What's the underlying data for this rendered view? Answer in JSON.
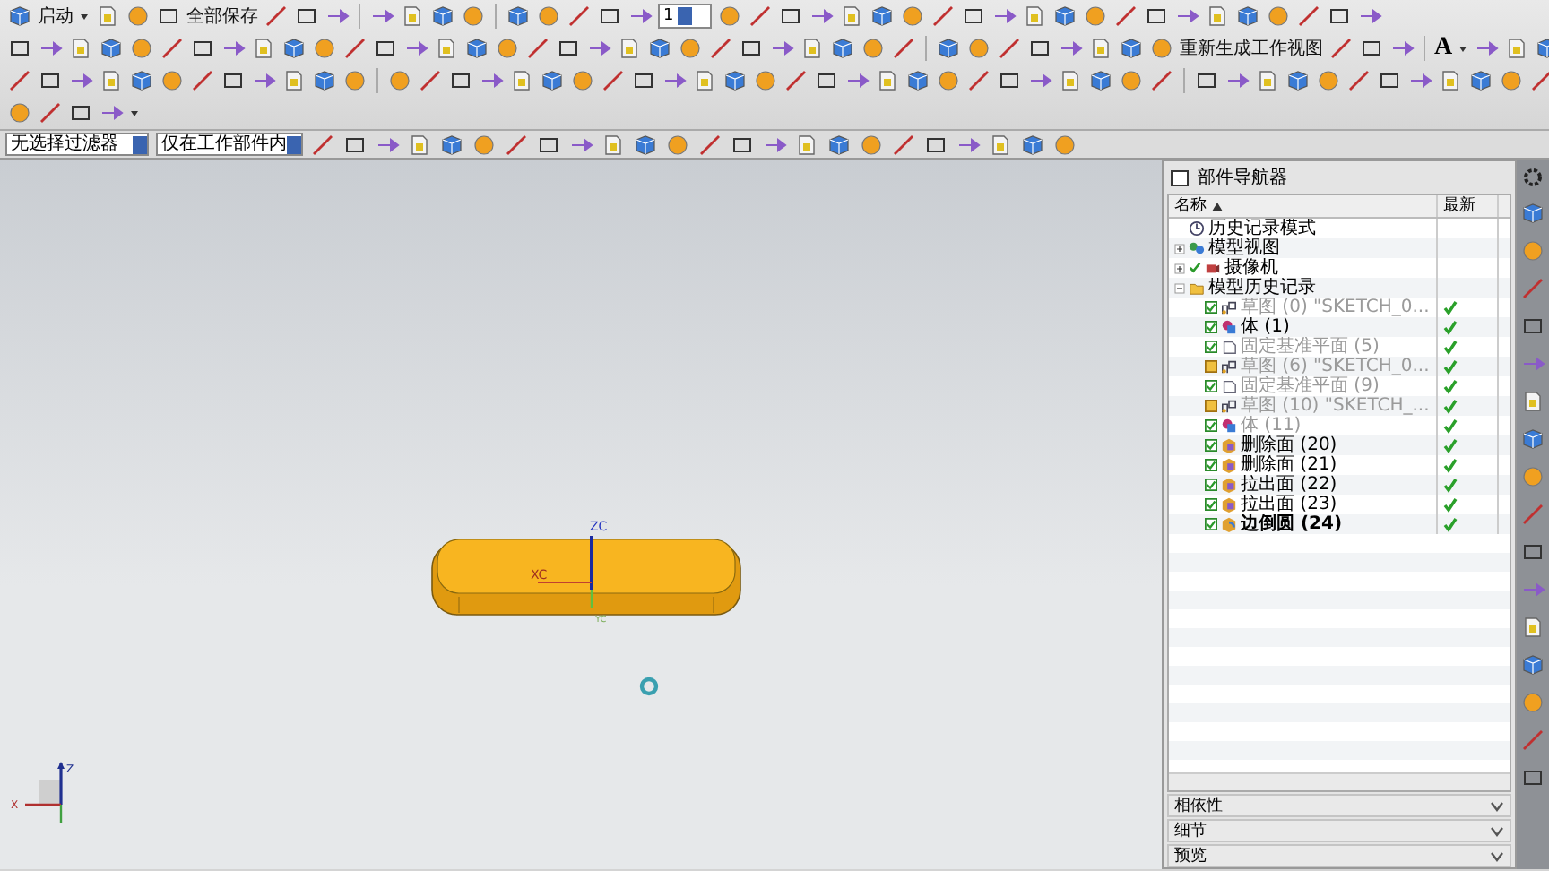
{
  "toolbar": {
    "start_label": "启动",
    "save_all_label": "全部保存",
    "layer_value": "1",
    "regenerate_label": "重新生成工作视图",
    "text_tool": "A"
  },
  "filter_bar": {
    "type_filter": "无选择过滤器",
    "scope_filter": "仅在工作部件内"
  },
  "viewport": {
    "axis_labels": [
      "ZC",
      "XC",
      "YC"
    ],
    "triad_labels": [
      "Z",
      "X"
    ]
  },
  "part_navigator": {
    "title": "部件导航器",
    "columns": [
      {
        "label": "名称",
        "sorted": true
      },
      {
        "label": "最新"
      }
    ],
    "tree": [
      {
        "label": "历史记录模式",
        "kind": "mode"
      },
      {
        "label": "模型视图",
        "kind": "views",
        "expanded": false
      },
      {
        "label": "摄像机",
        "kind": "camera",
        "expanded": false,
        "checked": true
      },
      {
        "label": "模型历史记录",
        "kind": "folder",
        "expanded": true,
        "children": [
          {
            "label": "草图 (0) \"SKETCH_0...",
            "kind": "sketch",
            "checked": true,
            "dimmed": true,
            "current": false,
            "up_to_date": true
          },
          {
            "label": "体 (1)",
            "kind": "body",
            "checked": true,
            "dimmed": false,
            "current": false,
            "up_to_date": true
          },
          {
            "label": "固定基准平面 (5)",
            "kind": "plane",
            "checked": true,
            "dimmed": true,
            "current": false,
            "up_to_date": true
          },
          {
            "label": "草图 (6) \"SKETCH_0...",
            "kind": "sketch",
            "checked": false,
            "dimmed": true,
            "current": false,
            "up_to_date": true
          },
          {
            "label": "固定基准平面 (9)",
            "kind": "plane",
            "checked": true,
            "dimmed": true,
            "current": false,
            "up_to_date": true
          },
          {
            "label": "草图 (10) \"SKETCH_...",
            "kind": "sketch",
            "checked": false,
            "dimmed": true,
            "current": false,
            "up_to_date": true
          },
          {
            "label": "体 (11)",
            "kind": "body",
            "checked": true,
            "dimmed": true,
            "current": false,
            "up_to_date": true
          },
          {
            "label": "删除面 (20)",
            "kind": "face",
            "checked": true,
            "dimmed": false,
            "current": false,
            "up_to_date": true
          },
          {
            "label": "删除面 (21)",
            "kind": "face",
            "checked": true,
            "dimmed": false,
            "current": false,
            "up_to_date": true
          },
          {
            "label": "拉出面 (22)",
            "kind": "face",
            "checked": true,
            "dimmed": false,
            "current": false,
            "up_to_date": true
          },
          {
            "label": "拉出面 (23)",
            "kind": "face",
            "checked": true,
            "dimmed": false,
            "current": false,
            "up_to_date": true
          },
          {
            "label": "边倒圆 (24)",
            "kind": "blend",
            "checked": true,
            "dimmed": false,
            "current": true,
            "up_to_date": true
          }
        ]
      }
    ],
    "sections": [
      {
        "label": "相依性",
        "expanded": false
      },
      {
        "label": "细节",
        "expanded": false
      },
      {
        "label": "预览",
        "expanded": false
      }
    ]
  }
}
